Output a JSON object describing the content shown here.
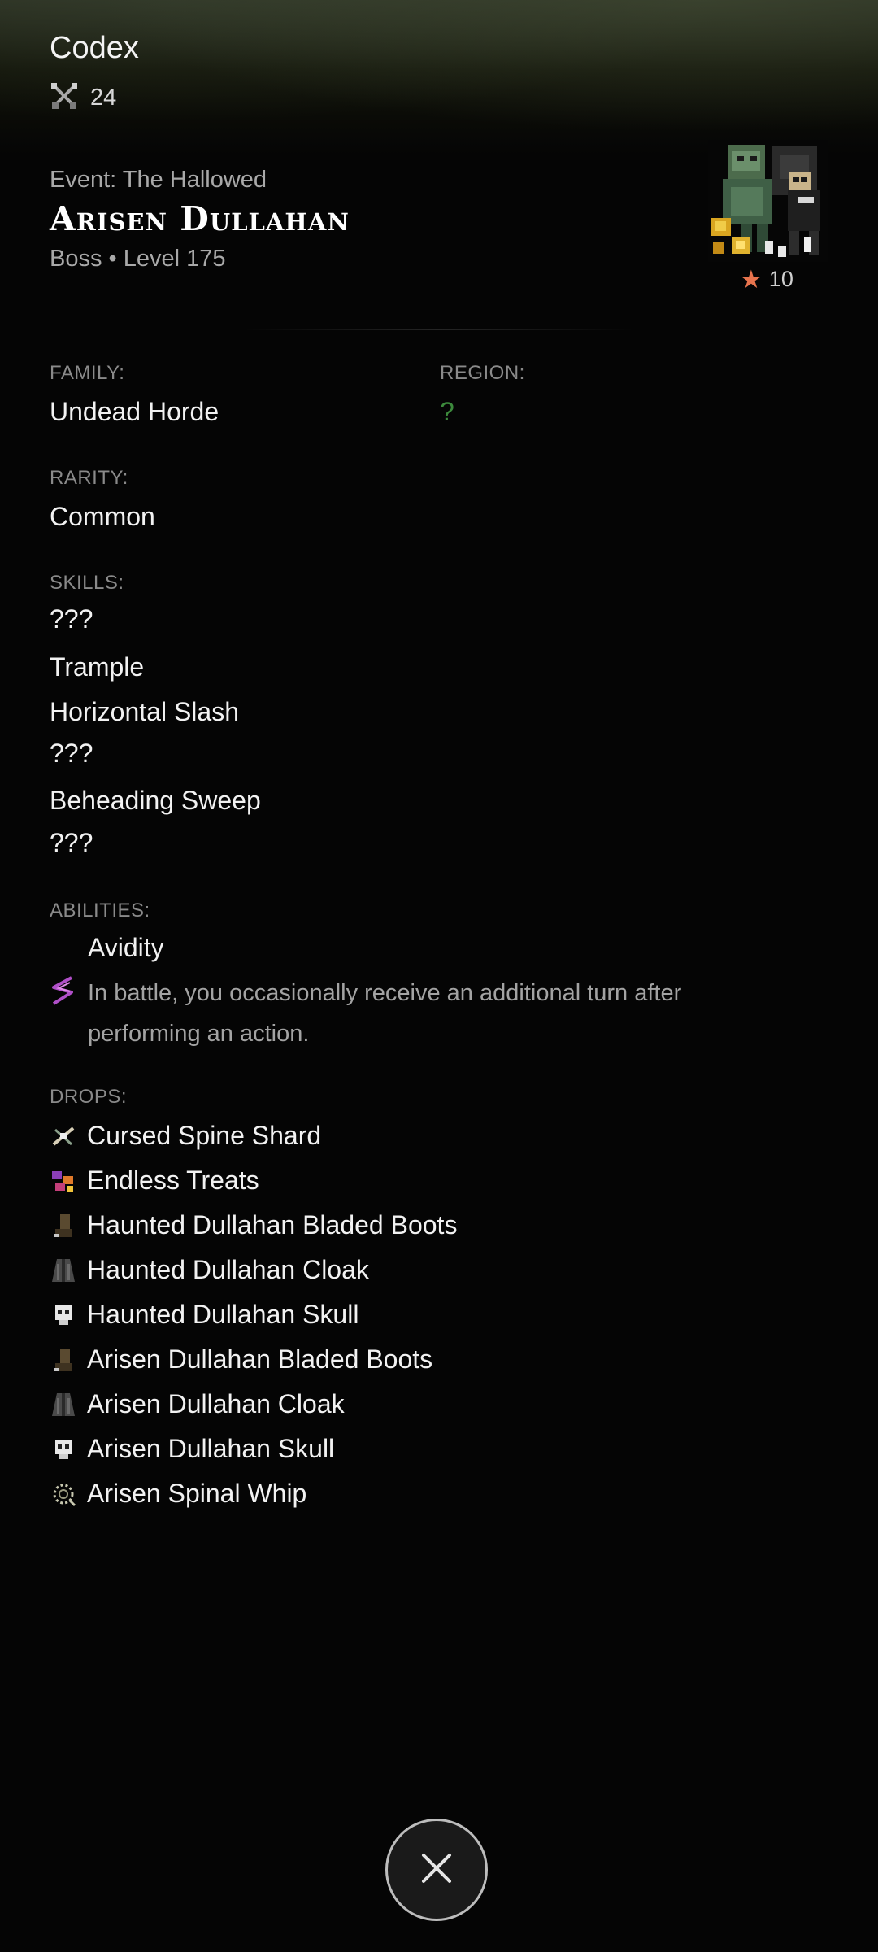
{
  "header": {
    "title": "Codex",
    "count": "24",
    "count_icon": "crossed-swords-icon"
  },
  "monster": {
    "event": "Event: The Hallowed",
    "name": "Arisen Dullahan",
    "meta": "Boss • Level 175",
    "stars": "10"
  },
  "fields": {
    "family_label": "FAMILY:",
    "family_value": "Undead Horde",
    "region_label": "REGION:",
    "region_value": "?",
    "rarity_label": "RARITY:",
    "rarity_value": "Common"
  },
  "skills": {
    "label": "SKILLS:",
    "items": [
      "???",
      "Trample",
      "Horizontal Slash",
      "???",
      "Beheading Sweep",
      "???"
    ]
  },
  "abilities": {
    "label": "ABILITIES:",
    "items": [
      {
        "name": "Avidity",
        "description": "In battle, you occasionally receive an additional turn after performing an action.",
        "icon": "purple-wave-icon"
      }
    ]
  },
  "drops": {
    "label": "DROPS:",
    "items": [
      {
        "label": "Cursed Spine Shard",
        "icon": "bone-shard-icon"
      },
      {
        "label": "Endless Treats",
        "icon": "candy-icon"
      },
      {
        "label": "Haunted Dullahan Bladed Boots",
        "icon": "boots-icon"
      },
      {
        "label": "Haunted Dullahan Cloak",
        "icon": "cloak-icon"
      },
      {
        "label": "Haunted Dullahan Skull",
        "icon": "skull-icon"
      },
      {
        "label": "Arisen Dullahan Bladed Boots",
        "icon": "boots-icon"
      },
      {
        "label": "Arisen Dullahan Cloak",
        "icon": "cloak-icon"
      },
      {
        "label": "Arisen Dullahan Skull",
        "icon": "skull-icon"
      },
      {
        "label": "Arisen Spinal Whip",
        "icon": "whip-icon"
      }
    ]
  },
  "colors": {
    "background": "#050505",
    "region_accent": "#3c8a3c",
    "star": "#e8744e",
    "muted_text": "#a9a9a9"
  }
}
